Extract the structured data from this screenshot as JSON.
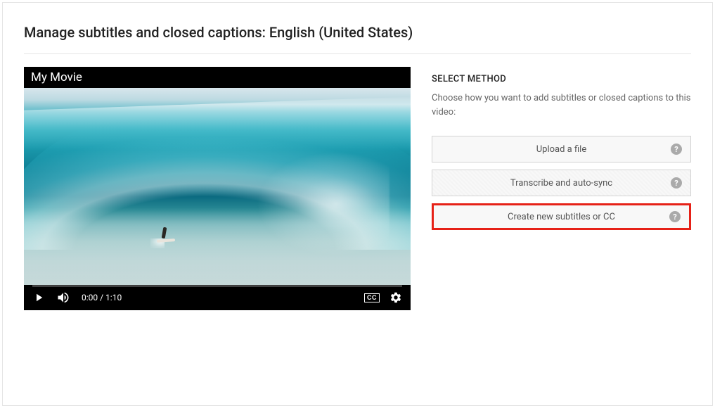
{
  "header": {
    "title": "Manage subtitles and closed captions: English (United States)"
  },
  "video": {
    "title": "My Movie",
    "time_current": "0:00",
    "time_sep": " / ",
    "time_total": "1:10",
    "cc_label": "CC"
  },
  "method": {
    "heading": "SELECT METHOD",
    "description": "Choose how you want to add subtitles or closed captions to this video:",
    "options": [
      {
        "label": "Upload a file"
      },
      {
        "label": "Transcribe and auto-sync"
      },
      {
        "label": "Create new subtitles or CC"
      }
    ],
    "help_glyph": "?"
  }
}
